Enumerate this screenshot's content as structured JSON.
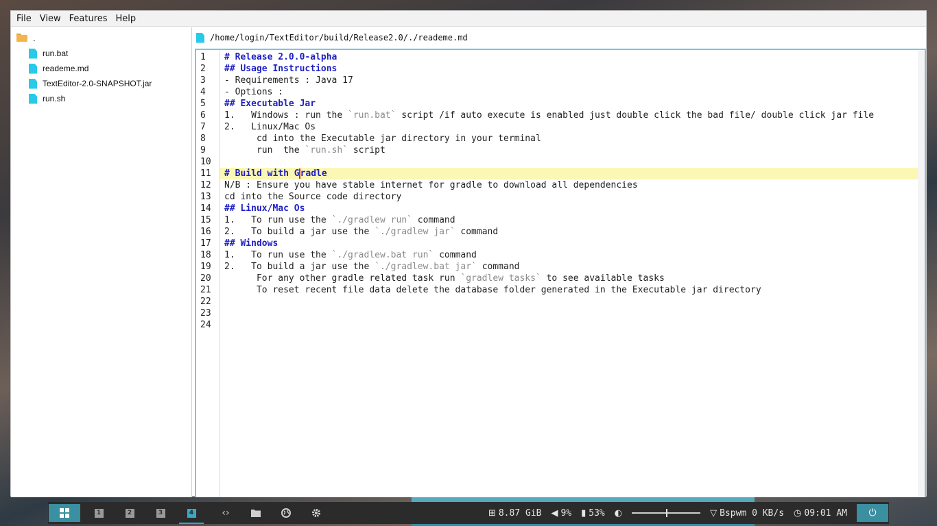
{
  "menubar": {
    "items": [
      "File",
      "View",
      "Features",
      "Help"
    ]
  },
  "sidebar": {
    "root_label": ".",
    "files": [
      "run.bat",
      "reademe.md",
      "TextEditor-2.0-SNAPSHOT.jar",
      "run.sh"
    ]
  },
  "editor": {
    "path": "/home/login/TextEditor/build/Release2.0/./reademe.md",
    "current_line": 11,
    "line_numbers": [
      "1",
      "2",
      "3",
      "4",
      "5",
      "6",
      "7",
      "8",
      "9",
      "10",
      "11",
      "12",
      "13",
      "14",
      "15",
      "16",
      "17",
      "18",
      "19",
      "20",
      "21",
      "22",
      "23",
      "24"
    ],
    "lines": [
      "# Release 2.0.0-alpha",
      "## Usage Instructions",
      "- Requirements : Java 17",
      "- Options :",
      "## Executable Jar",
      "1.   Windows : run the `run.bat` script /if auto execute is enabled just double click the bad file/ double click jar file",
      "2.   Linux/Mac Os",
      "      cd into the Executable jar directory in your terminal",
      "      run  the `run.sh` script",
      "",
      "# Build with Gradle",
      "N/B : Ensure you have stable internet for gradle to download all dependencies",
      "cd into the Source code directory",
      "## Linux/Mac Os",
      "1.   To run use the `./gradlew run` command",
      "2.   To build a jar use the `./gradlew jar` command",
      "## Windows",
      "1.   To run use the `./gradlew.bat run` command",
      "2.   To build a jar use the `./gradlew.bat jar` command",
      "      For any other gradle related task run `gradlew tasks` to see available tasks",
      "      To reset recent file data delete the database folder generated in the Executable jar directory",
      "",
      "",
      ""
    ]
  },
  "taskbar": {
    "workspaces": [
      "1",
      "2",
      "3",
      "4"
    ],
    "active_workspace": "4",
    "icons": [
      "code-icon",
      "folder-icon",
      "globe-icon",
      "gear-icon"
    ],
    "memory": "8.87 GiB",
    "volume": "9%",
    "battery": "53%",
    "brightness_level": 0.5,
    "network": "Bspwm 0 KB/s",
    "clock": "09:01 AM",
    "accent_color": "#3a8fa0"
  },
  "colors": {
    "heading": "#1d1fc4",
    "code_span": "#8a8a8a",
    "current_line_bg": "#fbf7b5",
    "file_icon": "#29c9e8"
  }
}
